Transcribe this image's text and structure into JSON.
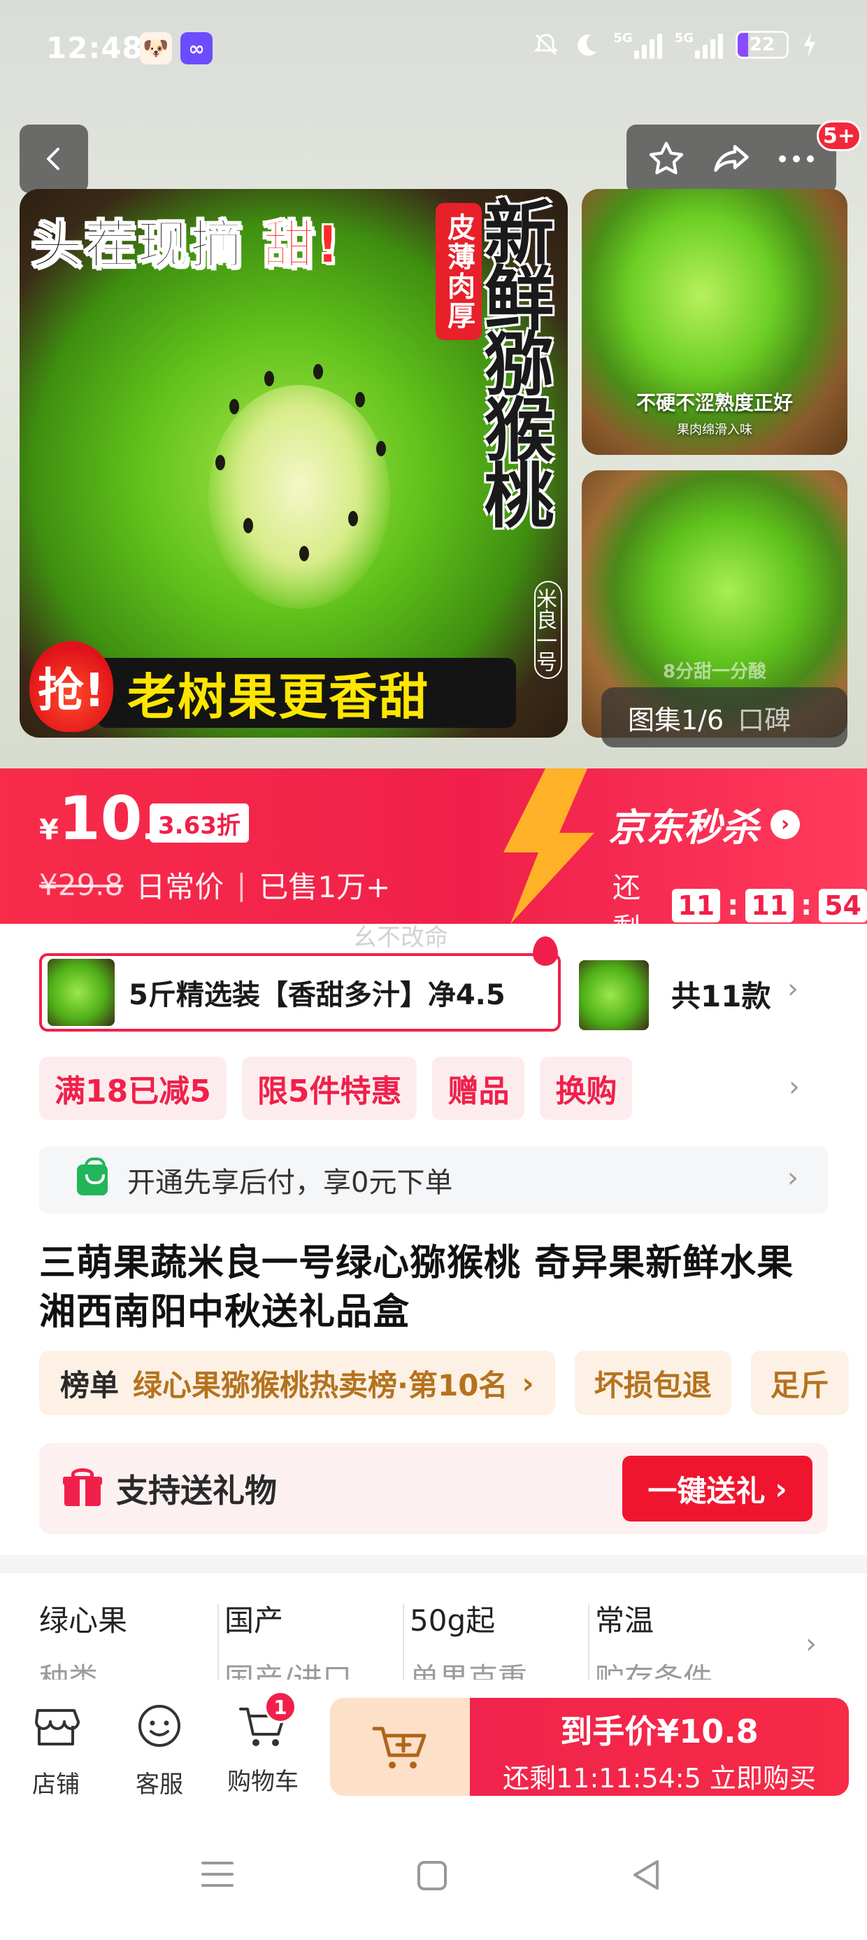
{
  "status_bar": {
    "time": "12:48",
    "signal1_label": "5G",
    "signal2_label": "5G",
    "battery": "22"
  },
  "gallery": {
    "main_top_text": "头茬现摘",
    "main_top_red": "甜!",
    "main_badge": "皮薄肉厚",
    "main_vertical": "新鲜猕猴桃",
    "main_variety": "米良一号",
    "main_bottom_flame": "抢!",
    "main_bottom_text": "老树果更香甜",
    "side1_caption": "不硬不涩熟度正好",
    "side1_sub": "果肉绵滑入味",
    "side2_caption": "8分甜一分酸",
    "counter_label": "图集1/6",
    "counter_reviews": "口碑",
    "notifications_badge": "5+"
  },
  "promo": {
    "currency": "¥",
    "price_int": "10",
    "price_dec": ".8",
    "discount": "3.63折",
    "original_price": "¥29.8",
    "original_label": "日常价",
    "sold": "已售1万+",
    "seckill_title": "京东秒杀",
    "countdown_label": "还剩",
    "countdown_h": "11",
    "countdown_m": "11",
    "countdown_s": "54"
  },
  "watermark": "幺不改命",
  "variant": {
    "selected_label": "5斤精选装【香甜多汁】净4.5",
    "count_label": "共11款"
  },
  "promo_tags": [
    "满18已减5",
    "限5件特惠",
    "赠品",
    "换购"
  ],
  "pay_later": "开通先享后付，享0元下单",
  "product_title": "三萌果蔬米良一号绿心猕猴桃 奇异果新鲜水果湘西南阳中秋送礼品盒",
  "rank": {
    "key": "榜单",
    "value": "绿心果猕猴桃热卖榜·第10名",
    "chips": [
      "坏损包退",
      "足斤"
    ]
  },
  "gift": {
    "text": "支持送礼物",
    "button": "一键送礼"
  },
  "specs": [
    {
      "value": "绿心果",
      "key": "种类"
    },
    {
      "value": "国产",
      "key": "国产/进口"
    },
    {
      "value": "50g起",
      "key": "单果克重"
    },
    {
      "value": "常温",
      "key": "贮存条件"
    }
  ],
  "bottom_bar": {
    "shop": "店铺",
    "service": "客服",
    "cart": "购物车",
    "cart_count": "1",
    "buy_line1": "到手价¥10.8",
    "buy_line2": "还剩11:11:54:5 立即购买"
  },
  "colors": {
    "accent": "#f0204a",
    "gold": "#b5721e",
    "green": "#22b55a"
  }
}
